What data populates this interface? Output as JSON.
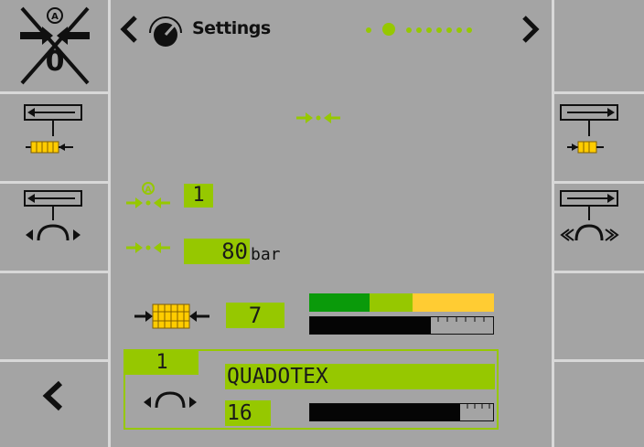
{
  "header": {
    "title": "Settings",
    "page_indicator": {
      "count": 9,
      "active_index": 1
    }
  },
  "sections": [
    {
      "label": "",
      "value": "1"
    },
    {
      "label": "",
      "value": "80",
      "unit": "bar"
    }
  ],
  "pressure_row": {
    "value": "7"
  },
  "level_bar": {
    "segments": [
      "#0a9a0a",
      "#96c800",
      "#ffcc33"
    ],
    "fill_fraction": 0.66
  },
  "device_box": {
    "index": "1",
    "name": "QUADOTEX",
    "value": "16",
    "fill_fraction": 0.82
  },
  "colors": {
    "accent": "#96c800",
    "background": "#a4a4a4",
    "divider": "#d8d8d8",
    "dark": "#101010"
  },
  "icons": {
    "top_left": "clamp-disabled-icon",
    "left_1": "move-left-clamp-icon",
    "left_2": "move-left-roll-icon",
    "right_1": "move-right-clamp-icon",
    "right_2": "move-right-roll-icon",
    "back": "back-arrow-icon",
    "header_prev": "chevron-left-icon",
    "header_next": "chevron-right-icon",
    "header_gauge": "gauge-icon"
  }
}
